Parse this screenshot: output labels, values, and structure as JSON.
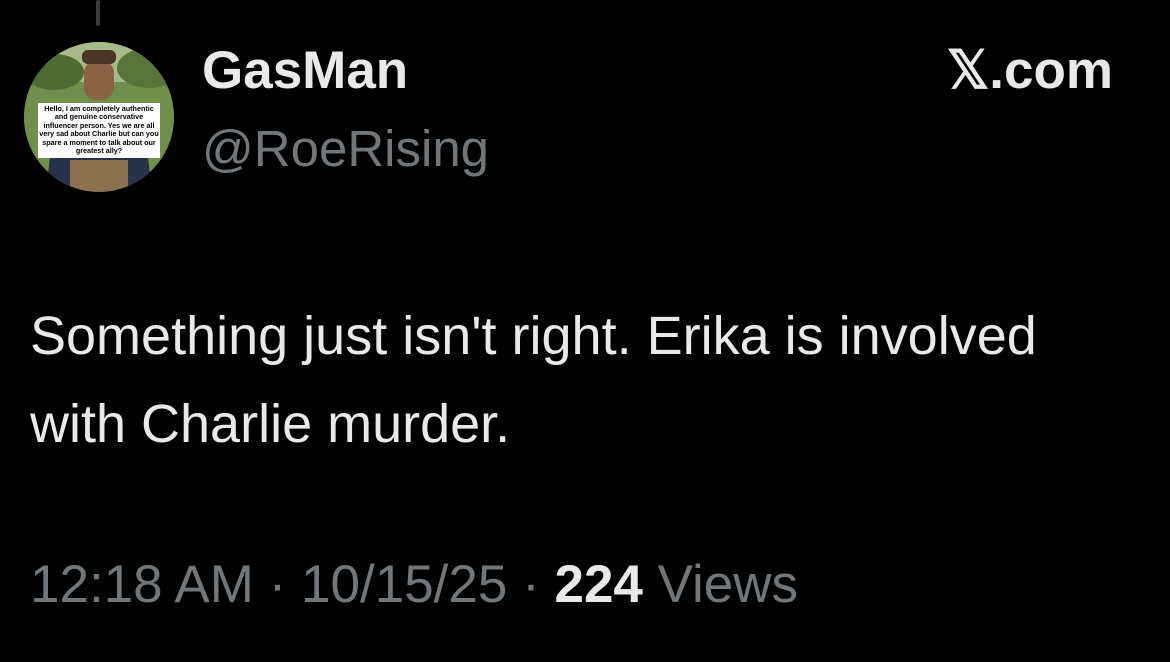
{
  "author": {
    "display_name": "GasMan",
    "handle": "@RoeRising",
    "avatar_caption": "Hello, I am completely authentic and genuine conservative influencer person. Yes we are all very sad about Charlie but can you spare a moment to talk about our greatest ally?"
  },
  "brand": {
    "label": "𝕏.com"
  },
  "tweet": {
    "text": "Something just isn't right. Erika is involved with Charlie murder."
  },
  "meta": {
    "time": "12:18 AM",
    "separator": " · ",
    "date": "10/15/25",
    "views_count": "224",
    "views_label": " Views"
  },
  "colors": {
    "background": "#000000",
    "primary_text": "#e7e9ea",
    "secondary_text": "#71767b"
  }
}
